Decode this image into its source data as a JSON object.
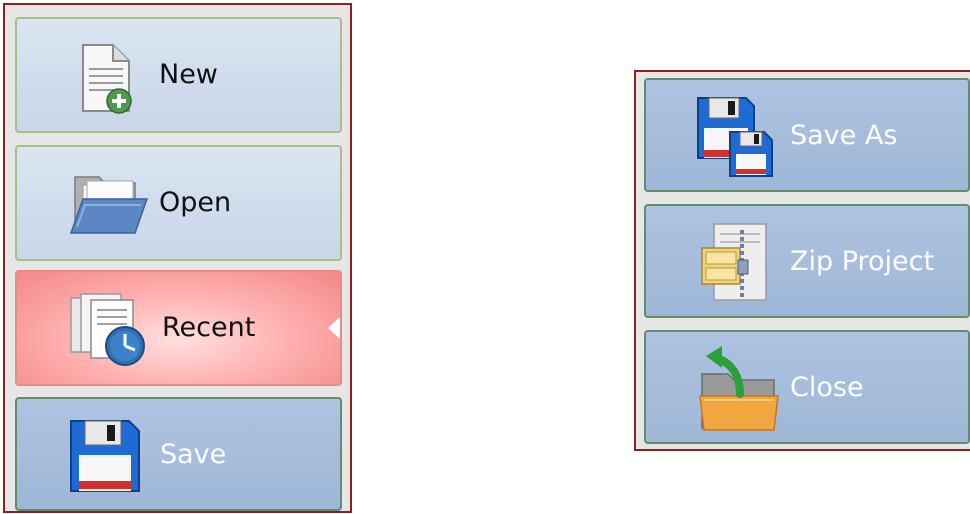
{
  "left_menu": {
    "items": [
      {
        "label": "New",
        "icon": "new-document-icon",
        "style": "light"
      },
      {
        "label": "Open",
        "icon": "open-folder-icon",
        "style": "light"
      },
      {
        "label": "Recent",
        "icon": "recent-documents-icon",
        "style": "selected"
      },
      {
        "label": "Save",
        "icon": "floppy-disk-icon",
        "style": "dark"
      }
    ]
  },
  "right_menu": {
    "items": [
      {
        "label": "Save As",
        "icon": "save-as-icon",
        "style": "dark"
      },
      {
        "label": "Zip Project",
        "icon": "zip-archive-icon",
        "style": "dark"
      },
      {
        "label": "Close",
        "icon": "close-folder-icon",
        "style": "dark"
      }
    ]
  },
  "colors": {
    "panel_border": "#8d2020",
    "selected_fill": "#f48787",
    "light_fill": "#cfdcec",
    "dark_fill": "#a6bddb"
  }
}
